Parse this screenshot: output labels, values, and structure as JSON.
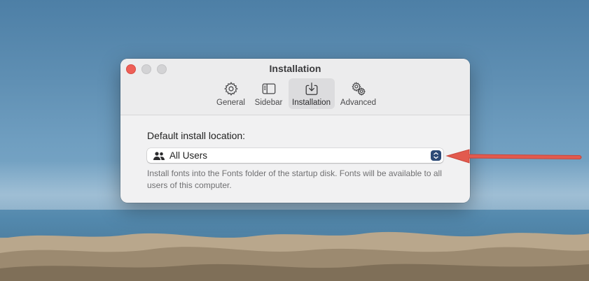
{
  "window": {
    "title": "Installation"
  },
  "toolbar": {
    "items": [
      {
        "label": "General",
        "icon": "gear-icon",
        "active": false
      },
      {
        "label": "Sidebar",
        "icon": "sidebar-icon",
        "active": false
      },
      {
        "label": "Installation",
        "icon": "download-tray-icon",
        "active": true
      },
      {
        "label": "Advanced",
        "icon": "gears-icon",
        "active": false
      }
    ]
  },
  "installation": {
    "location_label": "Default install location:",
    "location_value": "All Users",
    "location_icon": "users-icon",
    "help_text": "Install fonts into the Fonts folder of the startup disk. Fonts will be available to all users of this computer."
  },
  "colors": {
    "close": "#ee5f57",
    "stepper": "#2c4a76",
    "annotation_arrow": "#e25a4e"
  }
}
